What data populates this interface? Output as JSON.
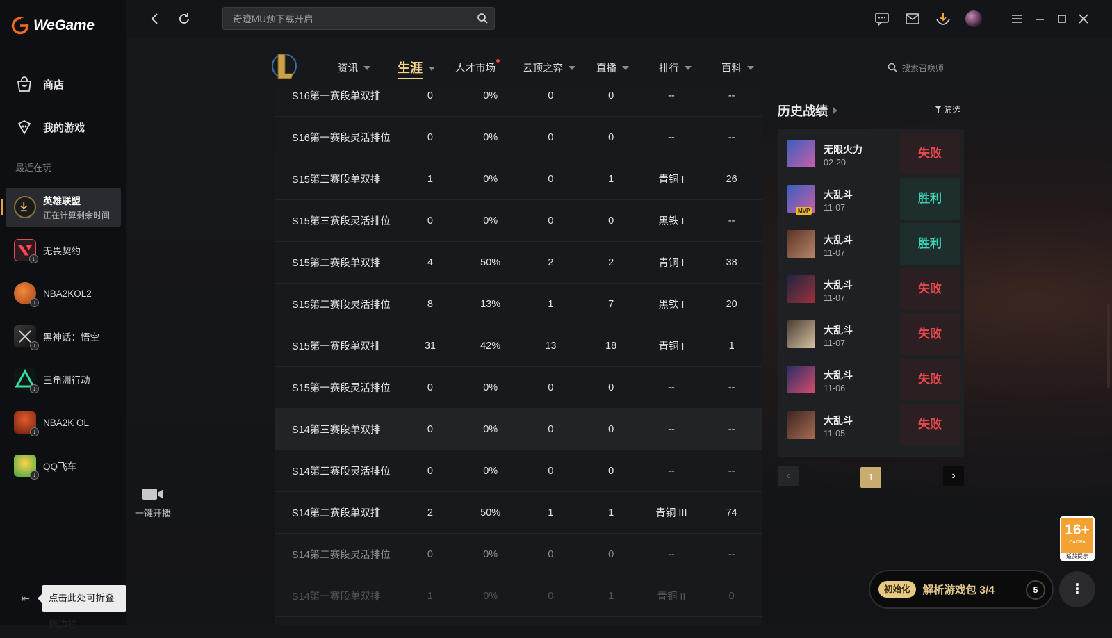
{
  "app": {
    "logo_text": "WeGame"
  },
  "sidebar": {
    "nav": [
      {
        "label": "商店",
        "icon": "store-icon"
      },
      {
        "label": "我的游戏",
        "icon": "my-games-icon"
      }
    ],
    "recent_label": "最近在玩",
    "games": [
      {
        "name": "英雄联盟",
        "sub": "正在计算剩余时间",
        "active": true
      },
      {
        "name": "无畏契约"
      },
      {
        "name": "NBA2KOL2"
      },
      {
        "name": "黑神话：悟空"
      },
      {
        "name": "三角洲行动"
      },
      {
        "name": "NBA2K OL"
      },
      {
        "name": "QQ飞车"
      }
    ],
    "collapse_tip": "点击此处可折叠侧边栏"
  },
  "topbar": {
    "search_placeholder": "奇迹MU预下载开启",
    "icons": [
      "back-icon",
      "refresh-icon",
      "chat-icon",
      "mail-icon",
      "download-icon",
      "avatar",
      "menu-icon",
      "minimize-icon",
      "maximize-icon",
      "close-icon"
    ]
  },
  "live": {
    "label": "一键开播"
  },
  "lol_nav": {
    "tabs": [
      {
        "label": "资讯",
        "caret": true
      },
      {
        "label": "生涯",
        "caret": true,
        "active": true
      },
      {
        "label": "人才市场",
        "dot": true
      },
      {
        "label": "云顶之弈",
        "caret": true
      },
      {
        "label": "直播",
        "caret": true
      },
      {
        "label": "排行",
        "caret": true
      },
      {
        "label": "百科",
        "caret": true
      }
    ],
    "summoner_search": "搜索召唤师"
  },
  "rank_table": {
    "rows": [
      [
        "S16第一赛段单双排",
        "0",
        "0%",
        "0",
        "0",
        "--",
        "--"
      ],
      [
        "S16第一赛段灵活排位",
        "0",
        "0%",
        "0",
        "0",
        "--",
        "--"
      ],
      [
        "S15第三赛段单双排",
        "1",
        "0%",
        "0",
        "1",
        "青铜 I",
        "26"
      ],
      [
        "S15第三赛段灵活排位",
        "0",
        "0%",
        "0",
        "0",
        "黑铁 I",
        "--"
      ],
      [
        "S15第二赛段单双排",
        "4",
        "50%",
        "2",
        "2",
        "青铜 I",
        "38"
      ],
      [
        "S15第二赛段灵活排位",
        "8",
        "13%",
        "1",
        "7",
        "黑铁 I",
        "20"
      ],
      [
        "S15第一赛段单双排",
        "31",
        "42%",
        "13",
        "18",
        "青铜 I",
        "1"
      ],
      [
        "S15第一赛段灵活排位",
        "0",
        "0%",
        "0",
        "0",
        "--",
        "--"
      ],
      [
        "S14第三赛段单双排",
        "0",
        "0%",
        "0",
        "0",
        "--",
        "--"
      ],
      [
        "S14第三赛段灵活排位",
        "0",
        "0%",
        "0",
        "0",
        "--",
        "--"
      ],
      [
        "S14第二赛段单双排",
        "2",
        "50%",
        "1",
        "1",
        "青铜 III",
        "74"
      ],
      [
        "S14第二赛段灵活排位",
        "0",
        "0%",
        "0",
        "0",
        "--",
        "--"
      ],
      [
        "S14第一赛段单双排",
        "1",
        "0%",
        "0",
        "1",
        "青铜 II",
        "0"
      ]
    ]
  },
  "history": {
    "title": "历史战绩",
    "filter": "筛选",
    "matches": [
      {
        "mode": "无限火力",
        "date": "02-20",
        "result": "失败",
        "win": false,
        "mvp": false,
        "colors": [
          "#3a5fbf",
          "#c95fa9"
        ]
      },
      {
        "mode": "大乱斗",
        "date": "11-07",
        "result": "胜利",
        "win": true,
        "mvp": true,
        "colors": [
          "#3a5fbf",
          "#c95fa9"
        ]
      },
      {
        "mode": "大乱斗",
        "date": "11-07",
        "result": "胜利",
        "win": true,
        "mvp": false,
        "colors": [
          "#5b3324",
          "#b9876a"
        ]
      },
      {
        "mode": "大乱斗",
        "date": "11-07",
        "result": "失败",
        "win": false,
        "mvp": false,
        "colors": [
          "#1e2540",
          "#a0303c"
        ]
      },
      {
        "mode": "大乱斗",
        "date": "11-07",
        "result": "失败",
        "win": false,
        "mvp": false,
        "colors": [
          "#4a3e34",
          "#d9c3a2"
        ]
      },
      {
        "mode": "大乱斗",
        "date": "11-06",
        "result": "失败",
        "win": false,
        "mvp": false,
        "colors": [
          "#2b2d66",
          "#d64d6d"
        ]
      },
      {
        "mode": "大乱斗",
        "date": "11-05",
        "result": "失败",
        "win": false,
        "mvp": false,
        "colors": [
          "#3d2420",
          "#a66d55"
        ]
      }
    ],
    "pager": {
      "page": "1",
      "prev": "‹",
      "next": "›"
    }
  },
  "age_rating": {
    "number": "16+",
    "sub": "CADPA",
    "text": "适龄提示"
  },
  "download_bar": {
    "init_label": "初始化",
    "status": "解析游戏包 3/4",
    "count": "5",
    "more": "⋮"
  }
}
